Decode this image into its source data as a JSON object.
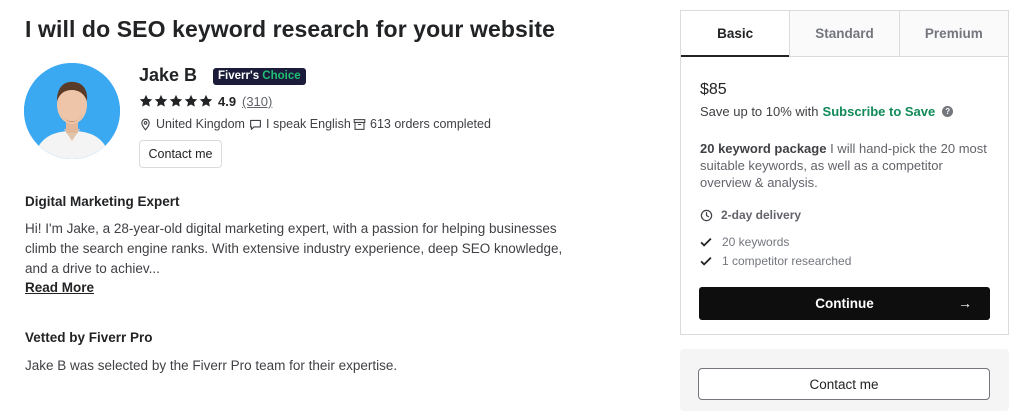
{
  "gig": {
    "title": "I will do SEO keyword research for your website"
  },
  "seller": {
    "name": "Jake B",
    "badge_part1": "Fiverr's",
    "badge_part2": "Choice",
    "rating": "4.9",
    "reviews": "(310)",
    "stars_filled": 5,
    "location": "United Kingdom",
    "language": "I speak English",
    "orders": "613 orders completed",
    "contact_label": "Contact me"
  },
  "about": {
    "heading": "Digital Marketing Expert",
    "text": "Hi! I'm Jake, a 28-year-old digital marketing expert, with a passion for helping businesses climb the search engine ranks. With extensive industry experience, deep SEO knowledge, and a drive to achiev...",
    "read_more": "Read More"
  },
  "vetted": {
    "heading": "Vetted by Fiverr Pro",
    "text": "Jake B was selected by the Fiverr Pro team for their expertise."
  },
  "package": {
    "tabs": [
      {
        "label": "Basic"
      },
      {
        "label": "Standard"
      },
      {
        "label": "Premium"
      }
    ],
    "price": "$85",
    "save_prefix": "Save up to 10% with",
    "save_link": "Subscribe to Save",
    "desc_bold": "20 keyword package",
    "desc_rest": " I will hand-pick the 20 most suitable keywords, as well as a competitor overview & analysis.",
    "delivery": "2-day delivery",
    "features": [
      "20 keywords",
      "1 competitor researched"
    ],
    "continue_label": "Continue"
  },
  "contact_panel": {
    "label": "Contact me"
  },
  "colors": {
    "accent_green": "#1dbf73",
    "badge_bg": "#1b1c3a",
    "button_dark": "#0e0e0e"
  }
}
